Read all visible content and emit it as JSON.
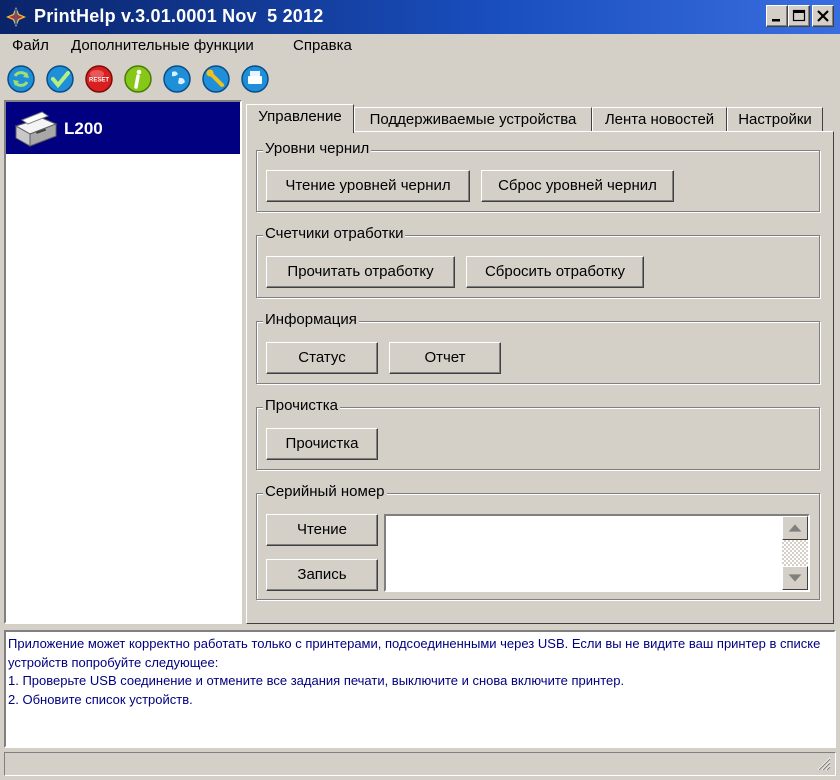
{
  "window": {
    "title": "PrintHelp v.3.01.0001 Nov  5 2012"
  },
  "menu": [
    "Файл",
    "Дополнительные функции",
    "Справка"
  ],
  "toolbar_icons": [
    "refresh-icon",
    "check-icon",
    "reset-icon",
    "info-icon",
    "globe-icon",
    "wrench-icon",
    "printer-icon"
  ],
  "toolbar_reset_label": "RESET",
  "devices": [
    {
      "label": "L200",
      "icon": "printer-icon"
    }
  ],
  "tabs": [
    "Управление",
    "Поддерживаемые устройства",
    "Лента новостей",
    "Настройки"
  ],
  "active_tab": 0,
  "groups": {
    "ink": {
      "title": "Уровни чернил",
      "read": "Чтение уровней чернил",
      "reset": "Сброс уровней чернил"
    },
    "counters": {
      "title": "Счетчики отработки",
      "read": "Прочитать отработку",
      "reset": "Сбросить отработку"
    },
    "info": {
      "title": "Информация",
      "status": "Статус",
      "report": "Отчет"
    },
    "cleaning": {
      "title": "Прочистка",
      "clean": "Прочистка"
    },
    "serial": {
      "title": "Серийный номер",
      "read": "Чтение",
      "write": "Запись",
      "value": ""
    }
  },
  "info_text": [
    "Приложение может корректно работать только с принтерами, подсоединенными через USB. Если вы не видите ваш принтер в списке устройств попробуйте следующее:",
    "1. Проверьте USB соединение и отмените все задания печати, выключите и снова включите принтер.",
    "2. Обновите список устройств."
  ],
  "colors": {
    "title_bar": "#0a246a",
    "selection": "#000080",
    "info_text": "#000080",
    "face": "#d4d0c8"
  }
}
